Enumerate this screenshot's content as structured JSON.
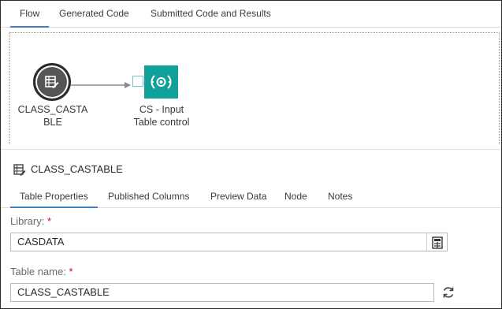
{
  "top_tabs": [
    {
      "label": "Flow",
      "active": true
    },
    {
      "label": "Generated Code",
      "active": false
    },
    {
      "label": "Submitted Code and Results",
      "active": false
    }
  ],
  "flow": {
    "table_node": {
      "label_line1": "CLASS_CASTA",
      "label_line2": "BLE",
      "icon": "table-edit-icon"
    },
    "control_node": {
      "label_line1": "CS - Input",
      "label_line2": "Table control",
      "icon": "input-control-icon",
      "color": "#12a19a"
    }
  },
  "properties": {
    "title": "CLASS_CASTABLE",
    "icon": "table-edit-icon",
    "tabs": [
      {
        "label": "Table Properties",
        "active": true
      },
      {
        "label": "Published Columns",
        "active": false
      },
      {
        "label": "Preview Data",
        "active": false
      },
      {
        "label": "Node",
        "active": false
      },
      {
        "label": "Notes",
        "active": false
      }
    ],
    "library": {
      "label": "Library:",
      "required_mark": "*",
      "value": "CASDATA",
      "button_icon": "browse-library-icon"
    },
    "table_name": {
      "label": "Table name:",
      "required_mark": "*",
      "value": "CLASS_CASTABLE",
      "button_icon": "refresh-icon"
    }
  },
  "colors": {
    "accent": "#3f7fbf",
    "required": "#d0021b",
    "control_node": "#12a19a",
    "table_node": "#555555"
  }
}
